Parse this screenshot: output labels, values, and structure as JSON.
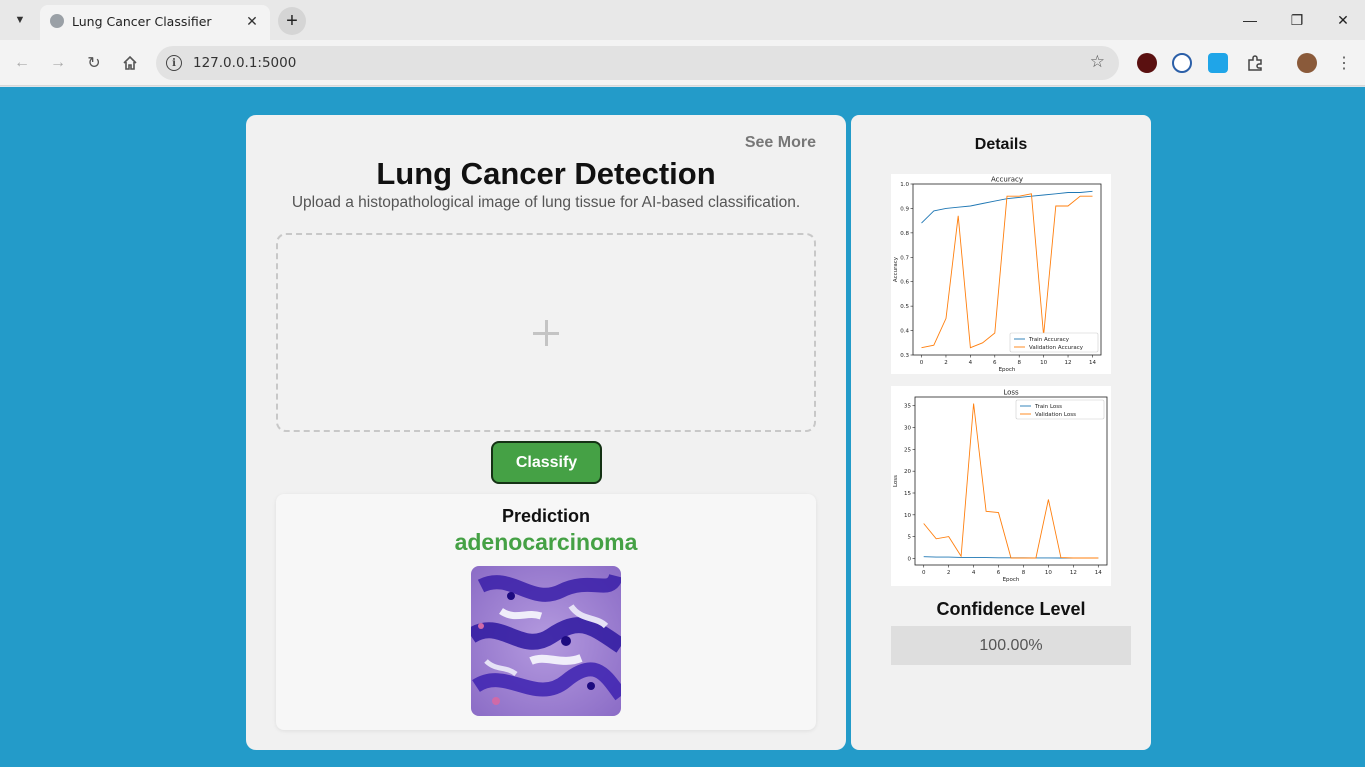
{
  "browser": {
    "tab_title": "Lung Cancer Classifier",
    "url": "127.0.0.1:5000"
  },
  "main": {
    "see_more": "See More",
    "title": "Lung Cancer Detection",
    "subtitle": "Upload a histopathological image of lung tissue for AI-based classification.",
    "upload_icon": "plus-icon",
    "classify_label": "Classify",
    "prediction_label": "Prediction",
    "prediction_value": "adenocarcinoma",
    "prediction_color": "#45a145"
  },
  "side": {
    "details_title": "Details",
    "confidence_title": "Confidence Level",
    "confidence_value": "100.00%"
  },
  "colors": {
    "page_background": "#239bc9",
    "train_series": "#1f77b4",
    "validation_series": "#ff7f0e"
  },
  "chart_data": [
    {
      "type": "line",
      "title": "Accuracy",
      "xlabel": "Epoch",
      "ylabel": "Accuracy",
      "x": [
        0,
        1,
        2,
        3,
        4,
        5,
        6,
        7,
        8,
        9,
        10,
        11,
        12,
        13,
        14
      ],
      "xticks": [
        "0",
        "2",
        "4",
        "6",
        "8",
        "10",
        "12",
        "14"
      ],
      "yticks": [
        "0.3",
        "0.4",
        "0.5",
        "0.6",
        "0.7",
        "0.8",
        "0.9",
        "1.0"
      ],
      "xlim": [
        -0.7,
        14.7
      ],
      "ylim": [
        0.3,
        1.0
      ],
      "legend": "bottom-right",
      "series": [
        {
          "name": "Train Accuracy",
          "values": [
            0.84,
            0.89,
            0.9,
            0.905,
            0.91,
            0.92,
            0.93,
            0.94,
            0.945,
            0.95,
            0.955,
            0.96,
            0.965,
            0.965,
            0.97
          ]
        },
        {
          "name": "Validation Accuracy",
          "values": [
            0.33,
            0.34,
            0.45,
            0.87,
            0.33,
            0.35,
            0.39,
            0.95,
            0.95,
            0.96,
            0.38,
            0.91,
            0.91,
            0.95,
            0.95
          ]
        }
      ]
    },
    {
      "type": "line",
      "title": "Loss",
      "xlabel": "Epoch",
      "ylabel": "Loss",
      "x": [
        0,
        1,
        2,
        3,
        4,
        5,
        6,
        7,
        8,
        9,
        10,
        11,
        12,
        13,
        14
      ],
      "xticks": [
        "0",
        "2",
        "4",
        "6",
        "8",
        "10",
        "12",
        "14"
      ],
      "yticks": [
        "0",
        "5",
        "10",
        "15",
        "20",
        "25",
        "30",
        "35"
      ],
      "xlim": [
        -0.7,
        14.7
      ],
      "ylim": [
        -1.5,
        37
      ],
      "legend": "top-right",
      "series": [
        {
          "name": "Train Loss",
          "values": [
            0.4,
            0.3,
            0.3,
            0.25,
            0.25,
            0.2,
            0.15,
            0.15,
            0.15,
            0.12,
            0.12,
            0.1,
            0.1,
            0.1,
            0.1
          ]
        },
        {
          "name": "Validation Loss",
          "values": [
            8.0,
            4.5,
            5.0,
            0.5,
            35.5,
            10.8,
            10.5,
            0.1,
            0.1,
            0.1,
            13.5,
            0.2,
            0.1,
            0.1,
            0.1
          ]
        }
      ]
    }
  ]
}
